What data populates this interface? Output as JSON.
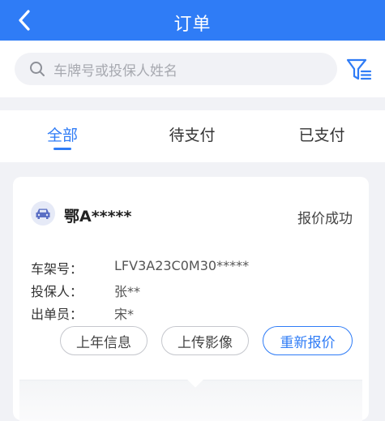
{
  "header": {
    "title": "订单",
    "back_icon": "chevron-left-icon"
  },
  "search": {
    "placeholder": "车牌号或投保人姓名",
    "icon": "search-icon",
    "filter_icon": "filter-list-icon"
  },
  "tabs": [
    {
      "label": "全部",
      "active": true
    },
    {
      "label": "待支付",
      "active": false
    },
    {
      "label": "已支付",
      "active": false
    }
  ],
  "order": {
    "avatar_icon": "car-icon",
    "plate": "鄂A*****",
    "status": "报价成功",
    "fields": [
      {
        "label": "车架号：",
        "value": "LFV3A23C0M30*****"
      },
      {
        "label": "投保人：",
        "value": "张**"
      },
      {
        "label": "出单员：",
        "value": "宋*"
      }
    ],
    "actions": {
      "last_year": "上年信息",
      "upload": "上传影像",
      "requote": "重新报价"
    }
  },
  "colors": {
    "primary": "#2f7cf6",
    "background": "#f1f2f6"
  }
}
